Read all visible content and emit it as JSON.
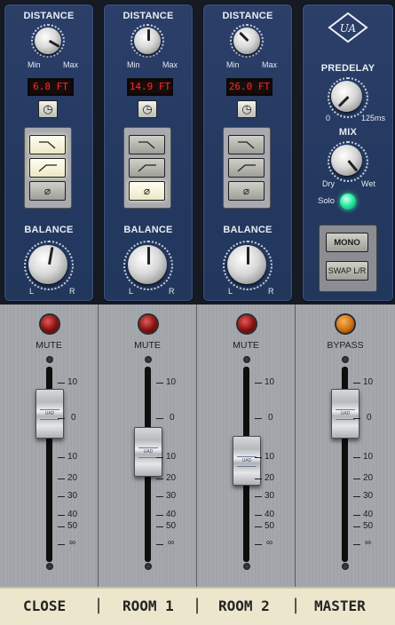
{
  "channels": [
    {
      "distance_label": "DISTANCE",
      "min": "Min",
      "max": "Max",
      "distance_value": "6.8 FT",
      "filters": [
        "low-cut",
        "high-cut",
        "phase"
      ],
      "filters_on": [
        true,
        true,
        false
      ],
      "balance_label": "BALANCE",
      "l": "L",
      "r": "R",
      "mute_label": "MUTE",
      "fader_scale": [
        "10",
        "0",
        "10",
        "20",
        "30",
        "40",
        "50",
        "∞"
      ]
    },
    {
      "distance_label": "DISTANCE",
      "min": "Min",
      "max": "Max",
      "distance_value": "14.9 FT",
      "filters": [
        "low-cut",
        "high-cut",
        "phase"
      ],
      "filters_on": [
        false,
        false,
        true
      ],
      "balance_label": "BALANCE",
      "l": "L",
      "r": "R",
      "mute_label": "MUTE",
      "fader_scale": [
        "10",
        "0",
        "10",
        "20",
        "30",
        "40",
        "50",
        "∞"
      ]
    },
    {
      "distance_label": "DISTANCE",
      "min": "Min",
      "max": "Max",
      "distance_value": "26.0 FT",
      "filters": [
        "low-cut",
        "high-cut",
        "phase"
      ],
      "filters_on": [
        false,
        false,
        false
      ],
      "balance_label": "BALANCE",
      "l": "L",
      "r": "R",
      "mute_label": "MUTE",
      "fader_scale": [
        "10",
        "0",
        "10",
        "20",
        "30",
        "40",
        "50",
        "∞"
      ]
    }
  ],
  "master": {
    "brand_logo": "ua-logo",
    "predelay_label": "PREDELAY",
    "predelay_min": "0",
    "predelay_max": "125ms",
    "mix_label": "MIX",
    "mix_min": "Dry",
    "mix_max": "Wet",
    "solo_label": "Solo",
    "mono_label": "MONO",
    "swap_label": "SWAP L/R",
    "bypass_label": "BYPASS",
    "fader_scale": [
      "10",
      "0",
      "10",
      "20",
      "30",
      "40",
      "50",
      "∞"
    ]
  },
  "footer": {
    "labels": [
      "CLOSE",
      "ROOM 1",
      "ROOM 2",
      "MASTER"
    ],
    "separator": "|"
  },
  "fader_cap_text": "UAD",
  "colors": {
    "panel": "#243960",
    "display_text": "#ff2b22",
    "solo_led": "#2cf0a0",
    "mute_led": "#8a1010",
    "bypass_led": "#d07010",
    "footer_bg": "#ebe6cc"
  }
}
